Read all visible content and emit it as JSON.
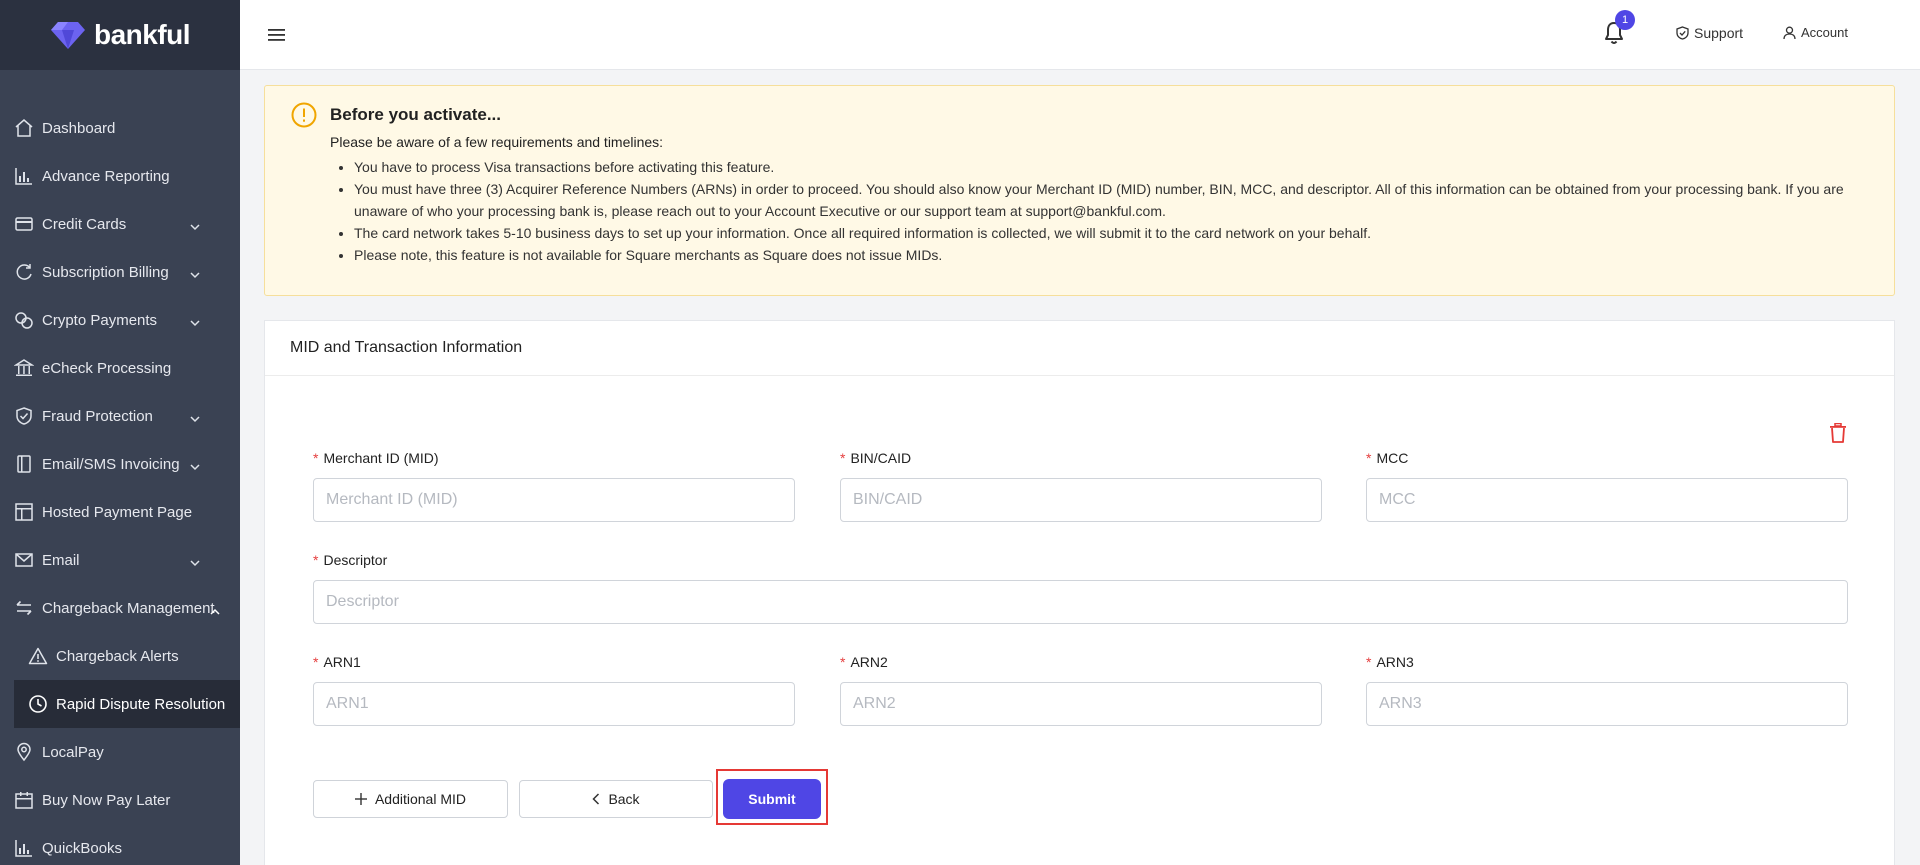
{
  "brand": {
    "name": "bankful"
  },
  "sidebar": {
    "items": [
      {
        "label": "Dashboard",
        "icon": "home-icon",
        "chevron": false
      },
      {
        "label": "Advance Reporting",
        "icon": "bar-chart-icon",
        "chevron": false
      },
      {
        "label": "Credit Cards",
        "icon": "credit-card-icon",
        "chevron": true
      },
      {
        "label": "Subscription Billing",
        "icon": "refresh-icon",
        "chevron": true
      },
      {
        "label": "Crypto Payments",
        "icon": "coins-icon",
        "chevron": true
      },
      {
        "label": "eCheck Processing",
        "icon": "bank-icon",
        "chevron": false
      },
      {
        "label": "Fraud Protection",
        "icon": "shield-icon",
        "chevron": true
      },
      {
        "label": "Email/SMS Invoicing",
        "icon": "invoice-icon",
        "chevron": true
      },
      {
        "label": "Hosted Payment Page",
        "icon": "layout-icon",
        "chevron": false
      },
      {
        "label": "Email",
        "icon": "mail-icon",
        "chevron": true
      },
      {
        "label": "Chargeback Management",
        "icon": "swap-icon",
        "chevron": true
      },
      {
        "label": "Chargeback Alerts",
        "icon": "warning-icon",
        "chevron": false
      },
      {
        "label": "Rapid Dispute Resolution",
        "icon": "clock-icon",
        "chevron": false
      },
      {
        "label": "LocalPay",
        "icon": "location-icon",
        "chevron": false
      },
      {
        "label": "Buy Now Pay Later",
        "icon": "calendar-icon",
        "chevron": false
      },
      {
        "label": "QuickBooks",
        "icon": "bar-chart-icon",
        "chevron": false
      }
    ]
  },
  "topbar": {
    "notification_count": "1",
    "support_label": "Support",
    "account_label": "Account"
  },
  "alert": {
    "title": "Before you activate...",
    "intro": "Please be aware of a few requirements and timelines:",
    "items": [
      "You have to process Visa transactions before activating this feature.",
      "You must have three (3) Acquirer Reference Numbers (ARNs) in order to proceed. You should also know your Merchant ID (MID) number, BIN, MCC, and descriptor. All of this information can be obtained from your processing bank. If you are unaware of who your processing bank is, please reach out to your Account Executive or our support team at support@bankful.com.",
      "The card network takes 5-10 business days to set up your information. Once all required information is collected, we will submit it to the card network on your behalf.",
      "Please note, this feature is not available for Square merchants as Square does not issue MIDs."
    ]
  },
  "form": {
    "title": "MID and Transaction Information",
    "mid": {
      "label": "Merchant ID (MID)",
      "placeholder": "Merchant ID (MID)",
      "value": ""
    },
    "bin": {
      "label": "BIN/CAID",
      "placeholder": "BIN/CAID",
      "value": ""
    },
    "mcc": {
      "label": "MCC",
      "placeholder": "MCC",
      "value": ""
    },
    "descriptor": {
      "label": "Descriptor",
      "placeholder": "Descriptor",
      "value": ""
    },
    "arn1": {
      "label": "ARN1",
      "placeholder": "ARN1",
      "value": ""
    },
    "arn2": {
      "label": "ARN2",
      "placeholder": "ARN2",
      "value": ""
    },
    "arn3": {
      "label": "ARN3",
      "placeholder": "ARN3",
      "value": ""
    },
    "required_mark": "*",
    "additional_mid_label": "Additional MID",
    "back_label": "Back",
    "submit_label": "Submit"
  },
  "colors": {
    "sidebar_bg": "#3a4253",
    "accent": "#4f46e5",
    "alert_bg": "#fff9e6",
    "danger": "#e53935"
  }
}
